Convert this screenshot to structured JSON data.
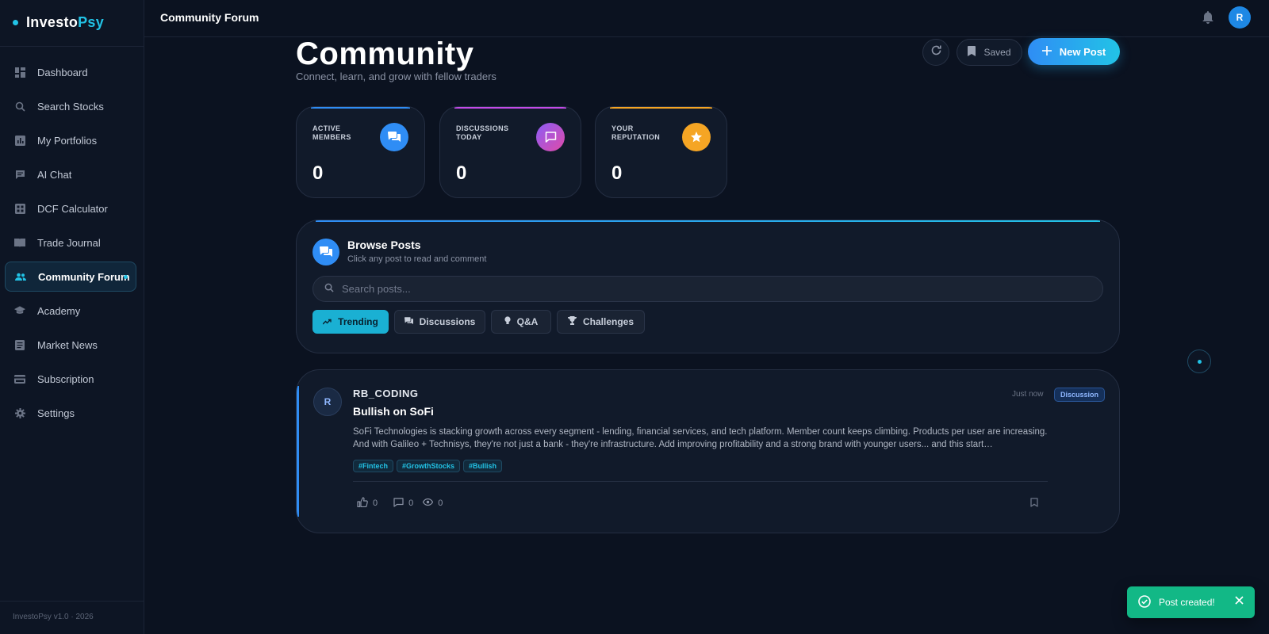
{
  "app": {
    "logo_main": "Investo",
    "logo_accent": "Psy",
    "version": "InvestoPsy v1.0 · 2026"
  },
  "sidebar": {
    "items": [
      {
        "label": "Dashboard",
        "icon": "dashboard-icon"
      },
      {
        "label": "Search Stocks",
        "icon": "search-icon"
      },
      {
        "label": "My Portfolios",
        "icon": "bar-chart-icon"
      },
      {
        "label": "AI Chat",
        "icon": "chat-icon"
      },
      {
        "label": "DCF Calculator",
        "icon": "calculator-icon"
      },
      {
        "label": "Trade Journal",
        "icon": "book-icon"
      },
      {
        "label": "Community Forum",
        "icon": "people-icon",
        "active": true
      },
      {
        "label": "Academy",
        "icon": "graduation-cap-icon"
      },
      {
        "label": "Market News",
        "icon": "news-icon"
      },
      {
        "label": "Subscription",
        "icon": "credit-card-icon"
      },
      {
        "label": "Settings",
        "icon": "gear-icon"
      }
    ]
  },
  "header": {
    "title": "Community Forum",
    "avatar_initial": "R"
  },
  "page": {
    "title": "Community",
    "subtitle": "Connect, learn, and grow with fellow traders",
    "saved_label": "Saved",
    "new_post_label": "New Post"
  },
  "stats": [
    {
      "label": "ACTIVE MEMBERS",
      "value": "0",
      "icon": "chat-bubbles-icon",
      "color": "#2f8df5"
    },
    {
      "label": "DISCUSSIONS TODAY",
      "value": "0",
      "icon": "message-icon",
      "color": "#c44be8"
    },
    {
      "label": "YOUR REPUTATION",
      "value": "0",
      "icon": "star-icon",
      "color": "#f5a524"
    }
  ],
  "browse": {
    "title": "Browse Posts",
    "subtitle": "Click any post to read and comment",
    "search_placeholder": "Search posts...",
    "filters": [
      {
        "label": "Trending",
        "icon": "trending-icon",
        "active": true
      },
      {
        "label": "Discussions",
        "icon": "chat-bubbles-icon"
      },
      {
        "label": "Q&A",
        "icon": "lightbulb-icon"
      },
      {
        "label": "Challenges",
        "icon": "trophy-icon"
      }
    ]
  },
  "post": {
    "avatar_initial": "R",
    "author": "RB_CODING",
    "title": "Bullish on SoFi",
    "time": "Just now",
    "badge": "Discussion",
    "body": "SoFi Technologies is stacking growth across every segment - lending, financial services, and tech platform. Member count keeps climbing. Products per user are increasing. And with Galileo + Technisys, they're not just a bank - they're infrastructure. Add improving profitability and a strong brand with younger users... and this start…",
    "tags": [
      "#Fintech",
      "#GrowthStocks",
      "#Bullish"
    ],
    "likes": "0",
    "comments": "0",
    "views": "0"
  },
  "toast": {
    "message": "Post created!"
  },
  "colors": {
    "accent": "#22c3e6",
    "primary": "#2f8df5",
    "success": "#12b886",
    "background": "#0b1220"
  }
}
